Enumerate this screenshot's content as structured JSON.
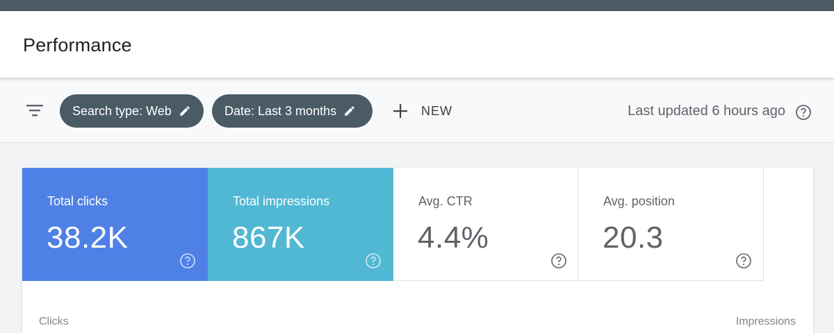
{
  "header": {
    "title": "Performance"
  },
  "toolbar": {
    "filter_icon": "filter-list-icon",
    "chips": [
      {
        "label": "Search type: Web",
        "icon": "edit-pencil-icon"
      },
      {
        "label": "Date: Last 3 months",
        "icon": "edit-pencil-icon"
      }
    ],
    "new_label": "NEW",
    "last_updated": "Last updated 6 hours ago"
  },
  "metrics": [
    {
      "label": "Total clicks",
      "value": "38.2K",
      "color": "#4f80e6",
      "selected": true
    },
    {
      "label": "Total impressions",
      "value": "867K",
      "color": "#51b8d4",
      "selected": true
    },
    {
      "label": "Avg. CTR",
      "value": "4.4%",
      "selected": false
    },
    {
      "label": "Avg. position",
      "value": "20.3",
      "selected": false
    }
  ],
  "chart": {
    "left_axis_label": "Clicks",
    "right_axis_label": "Impressions"
  },
  "colors": {
    "top_bar": "#4a5b66",
    "chip_bg": "#4a5b66",
    "clicks": "#4f80e6",
    "impressions": "#51b8d4"
  }
}
